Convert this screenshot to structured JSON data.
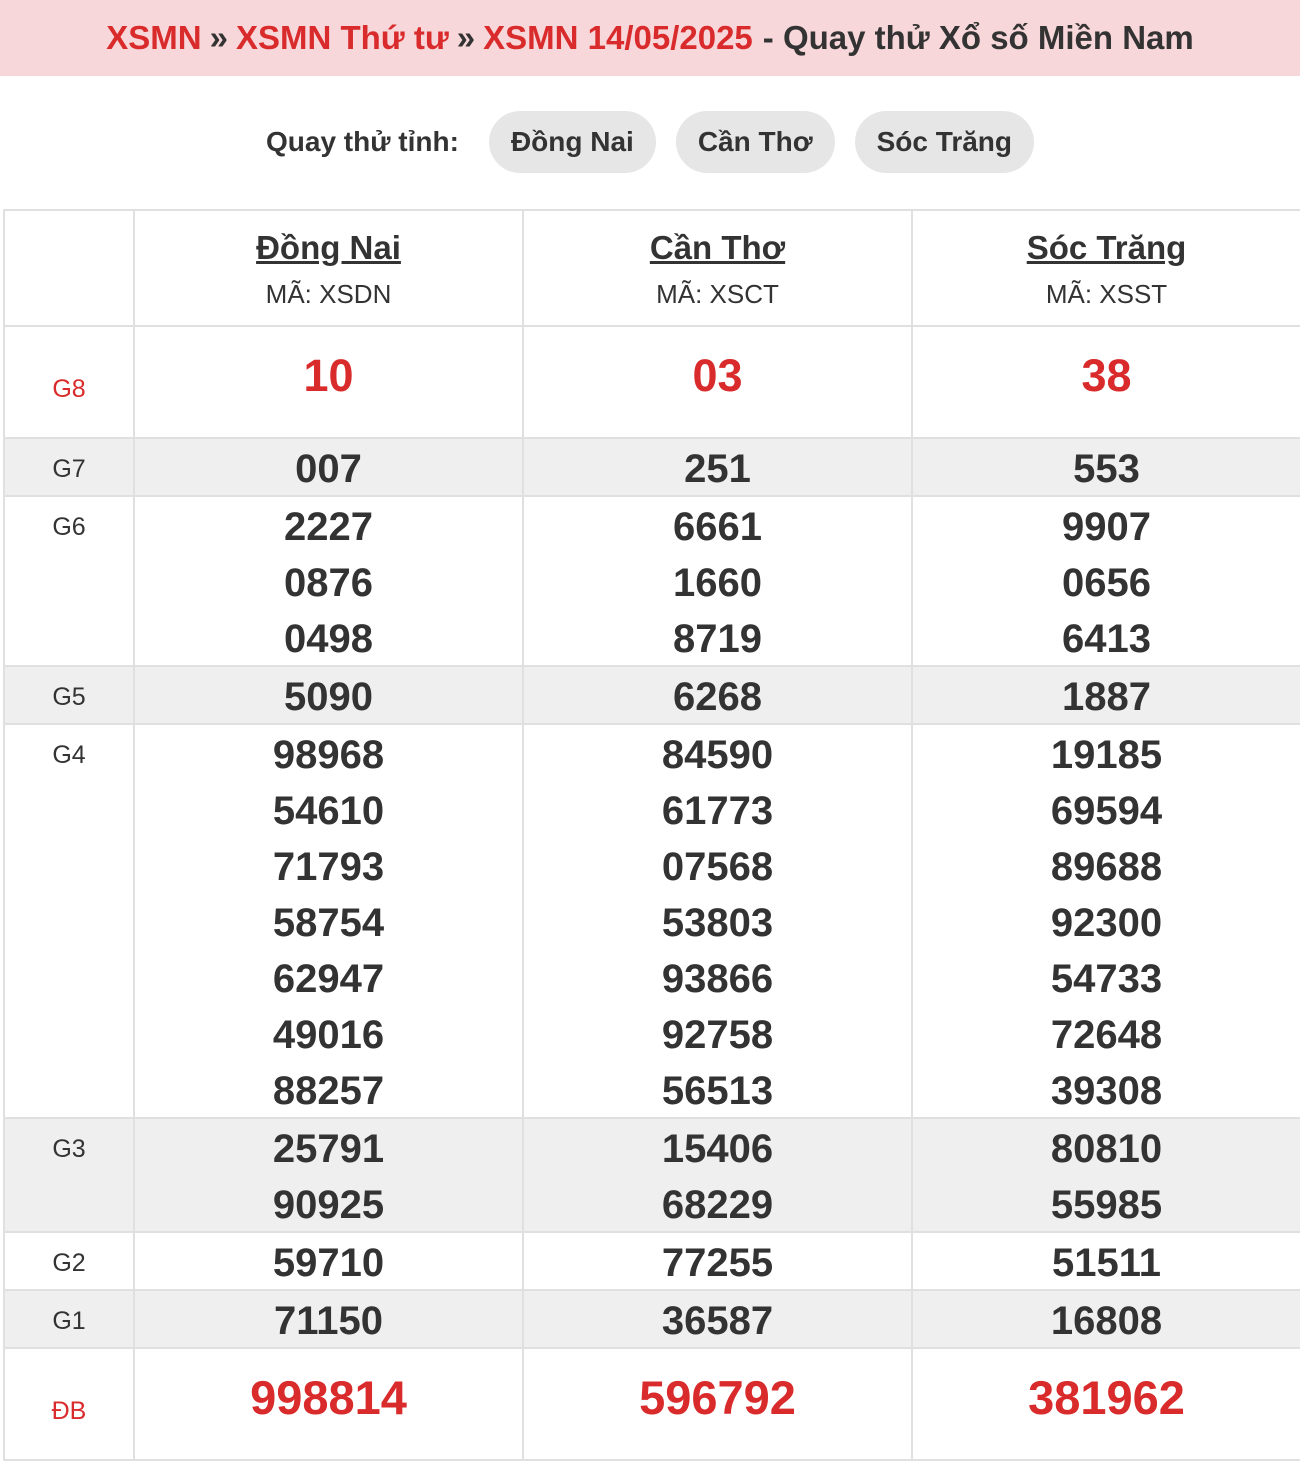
{
  "breadcrumb": {
    "home": "XSMN",
    "weekday": "XSMN Thứ tư",
    "date": "XSMN 14/05/2025",
    "suffix": "- Quay thử Xổ số Miền Nam",
    "separator": "»"
  },
  "picker": {
    "label": "Quay thử tỉnh:",
    "options": [
      "Đồng Nai",
      "Cần Thơ",
      "Sóc Trăng"
    ]
  },
  "provinces": [
    {
      "name": "Đồng Nai",
      "code": "MÃ: XSDN"
    },
    {
      "name": "Cần Thơ",
      "code": "MÃ: XSCT"
    },
    {
      "name": "Sóc Trăng",
      "code": "MÃ: XSST"
    }
  ],
  "prizes": [
    {
      "label": "G8",
      "values": [
        [
          "10"
        ],
        [
          "03"
        ],
        [
          "38"
        ]
      ]
    },
    {
      "label": "G7",
      "values": [
        [
          "007"
        ],
        [
          "251"
        ],
        [
          "553"
        ]
      ]
    },
    {
      "label": "G6",
      "values": [
        [
          "2227",
          "0876",
          "0498"
        ],
        [
          "6661",
          "1660",
          "8719"
        ],
        [
          "9907",
          "0656",
          "6413"
        ]
      ]
    },
    {
      "label": "G5",
      "values": [
        [
          "5090"
        ],
        [
          "6268"
        ],
        [
          "1887"
        ]
      ]
    },
    {
      "label": "G4",
      "values": [
        [
          "98968",
          "54610",
          "71793",
          "58754",
          "62947",
          "49016",
          "88257"
        ],
        [
          "84590",
          "61773",
          "07568",
          "53803",
          "93866",
          "92758",
          "56513"
        ],
        [
          "19185",
          "69594",
          "89688",
          "92300",
          "54733",
          "72648",
          "39308"
        ]
      ]
    },
    {
      "label": "G3",
      "values": [
        [
          "25791",
          "90925"
        ],
        [
          "15406",
          "68229"
        ],
        [
          "80810",
          "55985"
        ]
      ]
    },
    {
      "label": "G2",
      "values": [
        [
          "59710"
        ],
        [
          "77255"
        ],
        [
          "51511"
        ]
      ]
    },
    {
      "label": "G1",
      "values": [
        [
          "71150"
        ],
        [
          "36587"
        ],
        [
          "16808"
        ]
      ]
    },
    {
      "label": "ĐB",
      "values": [
        [
          "998814"
        ],
        [
          "596792"
        ],
        [
          "381962"
        ]
      ]
    }
  ],
  "colors": {
    "accent": "#d92b2b",
    "banner_bg": "#f8d7da",
    "alt_row": "#efefef",
    "pill_bg": "#e6e6e6"
  }
}
